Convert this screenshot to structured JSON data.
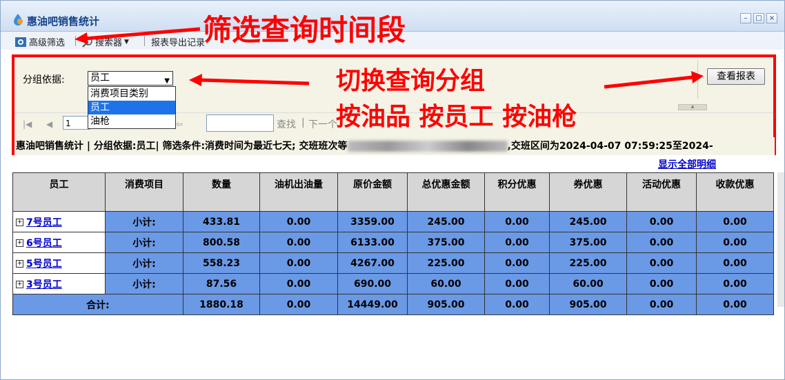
{
  "window": {
    "title": "惠油吧销售统计",
    "controls": [
      "–",
      "□",
      "×"
    ]
  },
  "toolbar": {
    "advanced_filter": "高级筛选",
    "searcher": "搜索器",
    "export": "报表导出记录"
  },
  "filter": {
    "group_label": "分组依据:",
    "group_selected": "员工",
    "group_options": [
      "消费项目类别",
      "员工",
      "油枪"
    ],
    "view_report": "查看报表",
    "page_value": "1",
    "find_label": "查找",
    "next_label": "下一个"
  },
  "status_line": {
    "part1": "惠油吧销售统计 | 分组依据:员工| 筛选条件:消费时间为最近七天; 交班班次等",
    "part2": ",交班区间为2024-04-07 07:59:25至2024-"
  },
  "show_all": "显示全部明细",
  "table": {
    "headers": [
      "员工",
      "消费项目",
      "数量",
      "油机出油量",
      "原价金额",
      "总优惠金额",
      "积分优惠",
      "券优惠",
      "活动优惠",
      "收款优惠"
    ],
    "rows": [
      {
        "employee": "7号员工",
        "item": "小计:",
        "qty": "433.81",
        "pump": "0.00",
        "orig": "3359.00",
        "total_disc": "245.00",
        "points": "0.00",
        "coupon": "245.00",
        "activity": "0.00",
        "payment": "0.00"
      },
      {
        "employee": "6号员工",
        "item": "小计:",
        "qty": "800.58",
        "pump": "0.00",
        "orig": "6133.00",
        "total_disc": "375.00",
        "points": "0.00",
        "coupon": "375.00",
        "activity": "0.00",
        "payment": "0.00"
      },
      {
        "employee": "5号员工",
        "item": "小计:",
        "qty": "558.23",
        "pump": "0.00",
        "orig": "4267.00",
        "total_disc": "225.00",
        "points": "0.00",
        "coupon": "225.00",
        "activity": "0.00",
        "payment": "0.00"
      },
      {
        "employee": "3号员工",
        "item": "小计:",
        "qty": "87.56",
        "pump": "0.00",
        "orig": "690.00",
        "total_disc": "60.00",
        "points": "0.00",
        "coupon": "60.00",
        "activity": "0.00",
        "payment": "0.00"
      }
    ],
    "total": {
      "label": "合计:",
      "qty": "1880.18",
      "pump": "0.00",
      "orig": "14449.00",
      "total_disc": "905.00",
      "points": "0.00",
      "coupon": "905.00",
      "activity": "0.00",
      "payment": "0.00"
    }
  },
  "annotations": {
    "a1": "筛选查询时间段",
    "a2": "切换查询分组",
    "a3": "按油品 按员工 按油枪",
    "color": "#ff0000"
  }
}
